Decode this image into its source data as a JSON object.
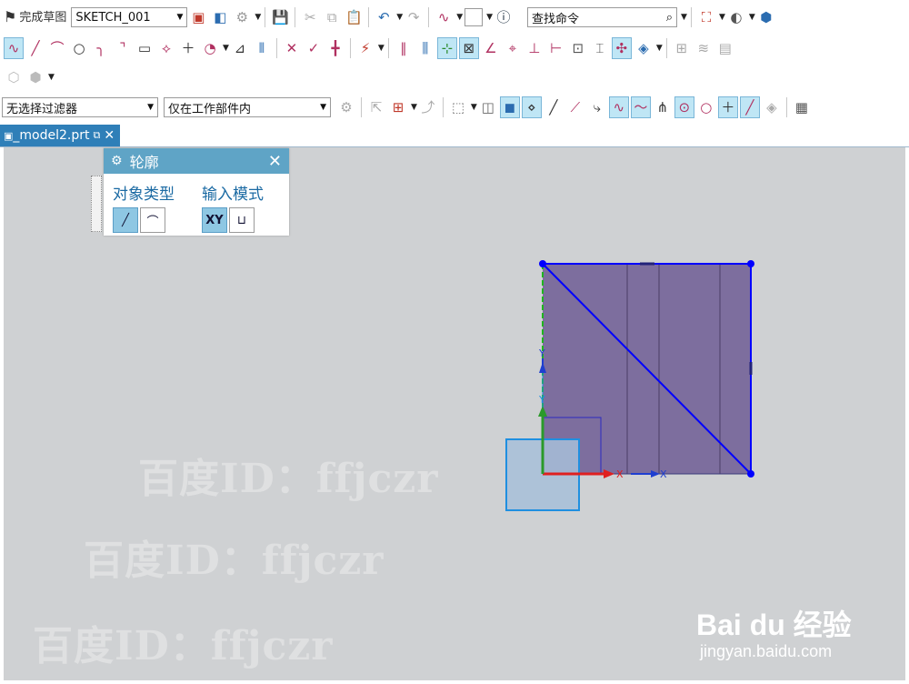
{
  "toolbar_row1": {
    "finish_sketch_label": "完成草图",
    "sketch_name": "SKETCH_001",
    "search_placeholder": "查找命令",
    "search_icon": "magnifier-icon"
  },
  "toolbar_row4": {
    "selection_filter": "无选择过滤器",
    "scope_filter": "仅在工作部件内"
  },
  "tab": {
    "label": "_model2.prt"
  },
  "profile_dialog": {
    "title": "轮廓",
    "object_type_label": "对象类型",
    "input_mode_label": "输入模式",
    "xy_label": "XY",
    "param_icon": "parameter-mode-icon"
  },
  "axes": {
    "x_label": "X",
    "y_label": "Y",
    "x2_label": "X",
    "y2_label": "Y"
  },
  "watermarks": [
    "百度ID：ffjczr",
    "百度ID：ffjczr",
    "百度ID：ffjczr"
  ],
  "baidu": {
    "logo": "Bai du 经验",
    "url": "jingyan.baidu.com"
  },
  "colors": {
    "accent": "#2f7fb8",
    "dialog_title": "#5fa4c6",
    "shape_fill": "#7d6e9e",
    "edge": "#0000ff"
  }
}
